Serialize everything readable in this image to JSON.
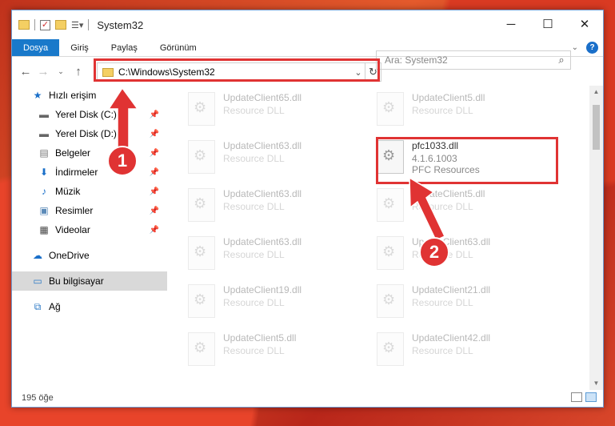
{
  "window": {
    "title": "System32",
    "controls": {
      "minimize": "─",
      "maximize": "☐",
      "close": "✕"
    }
  },
  "ribbon": {
    "tabs": [
      {
        "label": "Dosya",
        "active": true
      },
      {
        "label": "Giriş"
      },
      {
        "label": "Paylaş"
      },
      {
        "label": "Görünüm"
      }
    ],
    "help": "?"
  },
  "address": {
    "path": "C:\\Windows\\System32"
  },
  "search": {
    "placeholder": "Ara: System32"
  },
  "sidebar": {
    "quick_access": "Hızlı erişim",
    "items": [
      {
        "label": "Yerel Disk (C:)",
        "icon": "drive-icon",
        "pinned": true
      },
      {
        "label": "Yerel Disk (D:)",
        "icon": "drive-icon",
        "pinned": true
      },
      {
        "label": "Belgeler",
        "icon": "documents-icon",
        "pinned": true
      },
      {
        "label": "İndirmeler",
        "icon": "download-icon",
        "pinned": true
      },
      {
        "label": "Müzik",
        "icon": "music-icon",
        "pinned": true
      },
      {
        "label": "Resimler",
        "icon": "pictures-icon",
        "pinned": true
      },
      {
        "label": "Videolar",
        "icon": "videos-icon",
        "pinned": true
      }
    ],
    "onedrive": "OneDrive",
    "this_pc": "Bu bilgisayar",
    "network": "Ağ"
  },
  "files": [
    {
      "name": "UpdateClient65.dll",
      "type": "Resource DLL",
      "faded": true
    },
    {
      "name": "UpdateClient5.dll",
      "type": "Resource DLL",
      "faded": true
    },
    {
      "name": "UpdateClient63.dll",
      "type": "Resource DLL",
      "faded": true
    },
    {
      "name": "pfc1033.dll",
      "type": "4.1.6.1003",
      "type2": "PFC Resources",
      "faded": false
    },
    {
      "name": "UpdateClient63.dll",
      "type": "Resource DLL",
      "faded": true
    },
    {
      "name": "UpdateClient5.dll",
      "type": "Resource DLL",
      "faded": true
    },
    {
      "name": "UpdateClient63.dll",
      "type": "Resource DLL",
      "faded": true
    },
    {
      "name": "UpdateClient63.dll",
      "type": "Resource DLL",
      "faded": true
    },
    {
      "name": "UpdateClient19.dll",
      "type": "Resource DLL",
      "faded": true
    },
    {
      "name": "UpdateClient21.dll",
      "type": "Resource DLL",
      "faded": true
    },
    {
      "name": "UpdateClient5.dll",
      "type": "Resource DLL",
      "faded": true
    },
    {
      "name": "UpdateClient42.dll",
      "type": "Resource DLL",
      "faded": true
    }
  ],
  "status": {
    "count": "195 öğe"
  },
  "callouts": {
    "one": "1",
    "two": "2"
  },
  "colors": {
    "highlight": "#e03333",
    "accent": "#1979ca"
  }
}
